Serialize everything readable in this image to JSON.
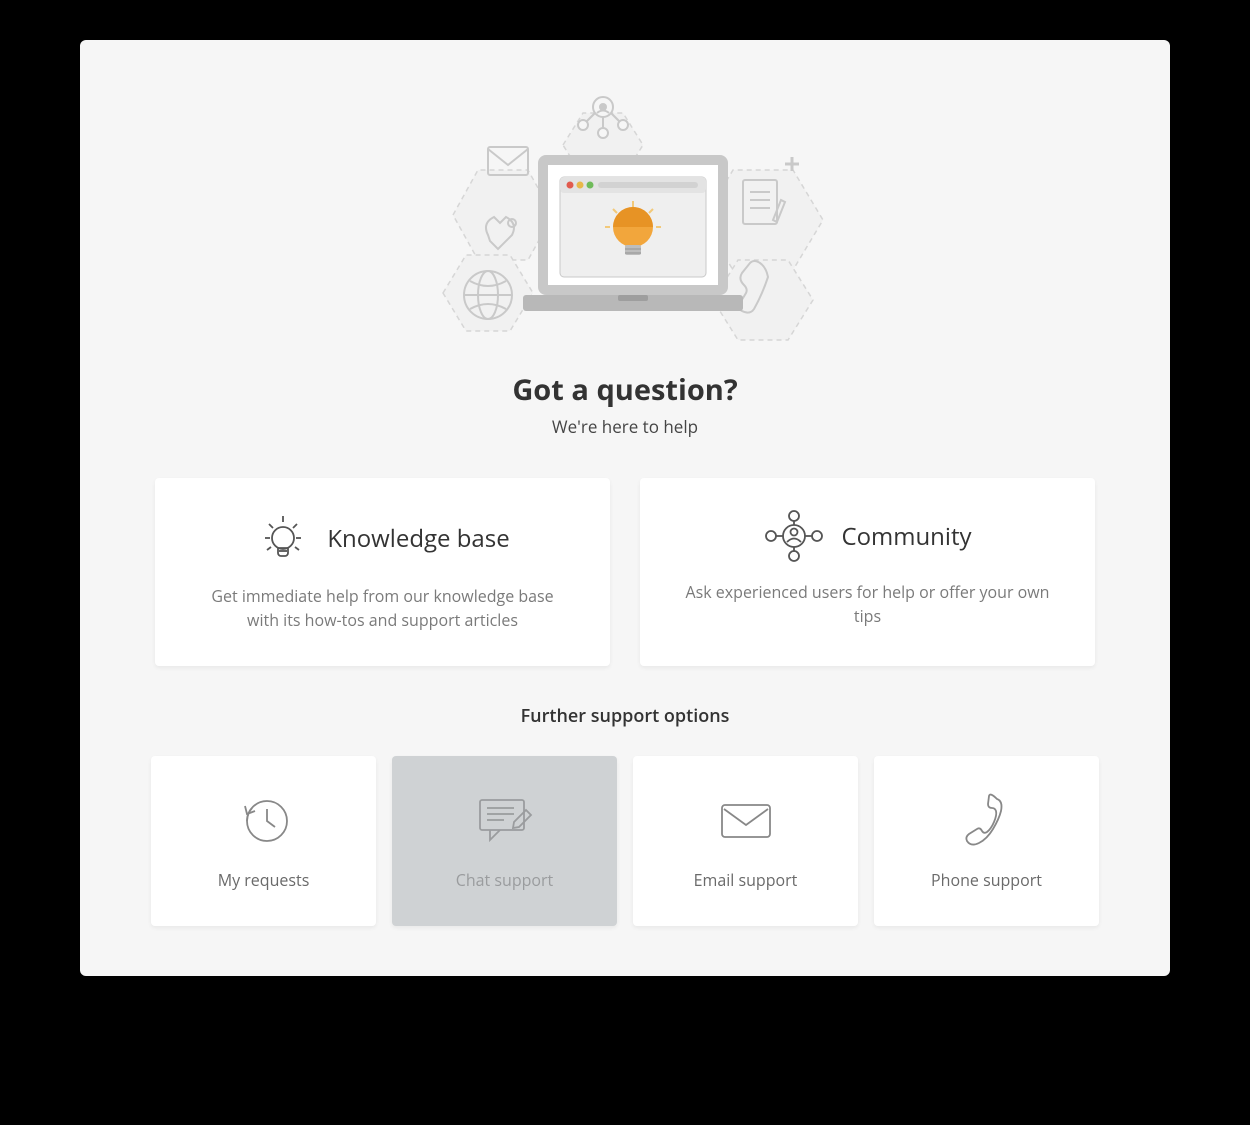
{
  "hero": {
    "title": "Got a question?",
    "subtitle": "We're here to help"
  },
  "main_cards": [
    {
      "icon": "lightbulb-icon",
      "title": "Knowledge base",
      "description": "Get immediate help from our knowledge base with its how-tos and support articles"
    },
    {
      "icon": "community-icon",
      "title": "Community",
      "description": "Ask experienced users for help or offer your own tips"
    }
  ],
  "further_heading": "Further support options",
  "options": [
    {
      "icon": "history-icon",
      "label": "My requests",
      "disabled": false
    },
    {
      "icon": "chat-edit-icon",
      "label": "Chat support",
      "disabled": true
    },
    {
      "icon": "envelope-icon",
      "label": "Email support",
      "disabled": false
    },
    {
      "icon": "phone-icon",
      "label": "Phone support",
      "disabled": false
    }
  ]
}
